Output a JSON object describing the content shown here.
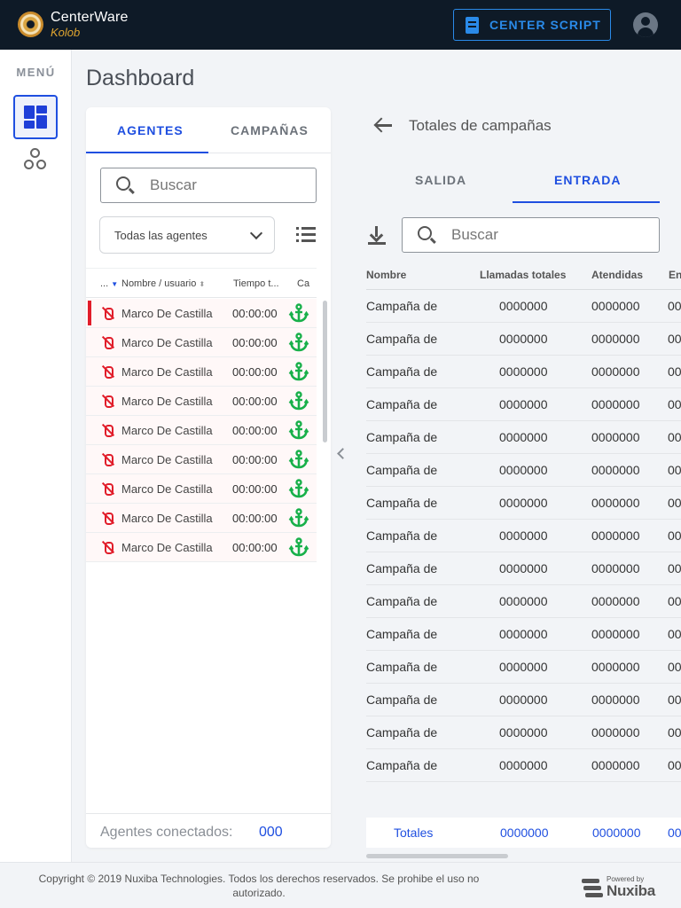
{
  "header": {
    "brand_name": "CenterWare",
    "brand_sub": "Kolob",
    "script_button_label": "CENTER SCRIPT",
    "icons": {
      "brand": "centerware-logo-icon",
      "script": "document-icon",
      "user": "account-circle-icon"
    }
  },
  "sidebar": {
    "menu_label": "MENÚ",
    "items": [
      {
        "icon": "dashboard-icon",
        "active": true
      },
      {
        "icon": "circles-group-icon",
        "active": false
      }
    ]
  },
  "page": {
    "title": "Dashboard"
  },
  "agents_panel": {
    "tabs": [
      {
        "label": "AGENTES",
        "active": true
      },
      {
        "label": "CAMPAÑAS",
        "active": false
      }
    ],
    "search_placeholder": "Buscar",
    "filter_value": "Todas las agentes",
    "columns": [
      "...",
      "Nombre / usuario",
      "Tiempo t...",
      "Ca"
    ],
    "rows": [
      {
        "name": "Marco De Castilla",
        "time": "00:00:00",
        "selected": true
      },
      {
        "name": "Marco De Castilla",
        "time": "00:00:00",
        "selected": false
      },
      {
        "name": "Marco De Castilla",
        "time": "00:00:00",
        "selected": false
      },
      {
        "name": "Marco De Castilla",
        "time": "00:00:00",
        "selected": false
      },
      {
        "name": "Marco De Castilla",
        "time": "00:00:00",
        "selected": false
      },
      {
        "name": "Marco De Castilla",
        "time": "00:00:00",
        "selected": false
      },
      {
        "name": "Marco De Castilla",
        "time": "00:00:00",
        "selected": false
      },
      {
        "name": "Marco De Castilla",
        "time": "00:00:00",
        "selected": false
      },
      {
        "name": "Marco De Castilla",
        "time": "00:00:00",
        "selected": false
      }
    ],
    "status_icon": "mic-off-icon",
    "campaign_icon": "anchor-icon",
    "footer_label": "Agentes conectados:",
    "footer_value": "000"
  },
  "campaigns_panel": {
    "title": "Totales de campañas",
    "tabs": [
      {
        "label": "SALIDA",
        "active": false
      },
      {
        "label": "ENTRADA",
        "active": true
      }
    ],
    "search_placeholder": "Buscar",
    "columns": [
      "Nombre",
      "Llamadas totales",
      "Atendidas",
      "En"
    ],
    "rows": [
      [
        "Campaña de",
        "0000000",
        "0000000",
        "00"
      ],
      [
        "Campaña de",
        "0000000",
        "0000000",
        "00"
      ],
      [
        "Campaña de",
        "0000000",
        "0000000",
        "00"
      ],
      [
        "Campaña de",
        "0000000",
        "0000000",
        "00"
      ],
      [
        "Campaña de",
        "0000000",
        "0000000",
        "00"
      ],
      [
        "Campaña de",
        "0000000",
        "0000000",
        "00"
      ],
      [
        "Campaña de",
        "0000000",
        "0000000",
        "00"
      ],
      [
        "Campaña de",
        "0000000",
        "0000000",
        "00"
      ],
      [
        "Campaña de",
        "0000000",
        "0000000",
        "00"
      ],
      [
        "Campaña de",
        "0000000",
        "0000000",
        "00"
      ],
      [
        "Campaña de",
        "0000000",
        "0000000",
        "00"
      ],
      [
        "Campaña de",
        "0000000",
        "0000000",
        "00"
      ],
      [
        "Campaña de",
        "0000000",
        "0000000",
        "00"
      ],
      [
        "Campaña de",
        "0000000",
        "0000000",
        "00"
      ],
      [
        "Campaña de",
        "0000000",
        "0000000",
        "00"
      ]
    ],
    "totals": [
      "Totales",
      "0000000",
      "0000000",
      "00"
    ]
  },
  "footer": {
    "copyright": "Copyright © 2019 Nuxiba Technologies. Todos los derechos reservados. Se prohibe el uso no autorizado.",
    "powered_by": "Powered by",
    "vendor": "Nuxiba"
  },
  "colors": {
    "accent": "#1f4fe0",
    "header_bg": "#0e1a27",
    "script_blue": "#2a8ae8",
    "alert_red": "#e11d2a",
    "anchor_green": "#18b04a"
  }
}
